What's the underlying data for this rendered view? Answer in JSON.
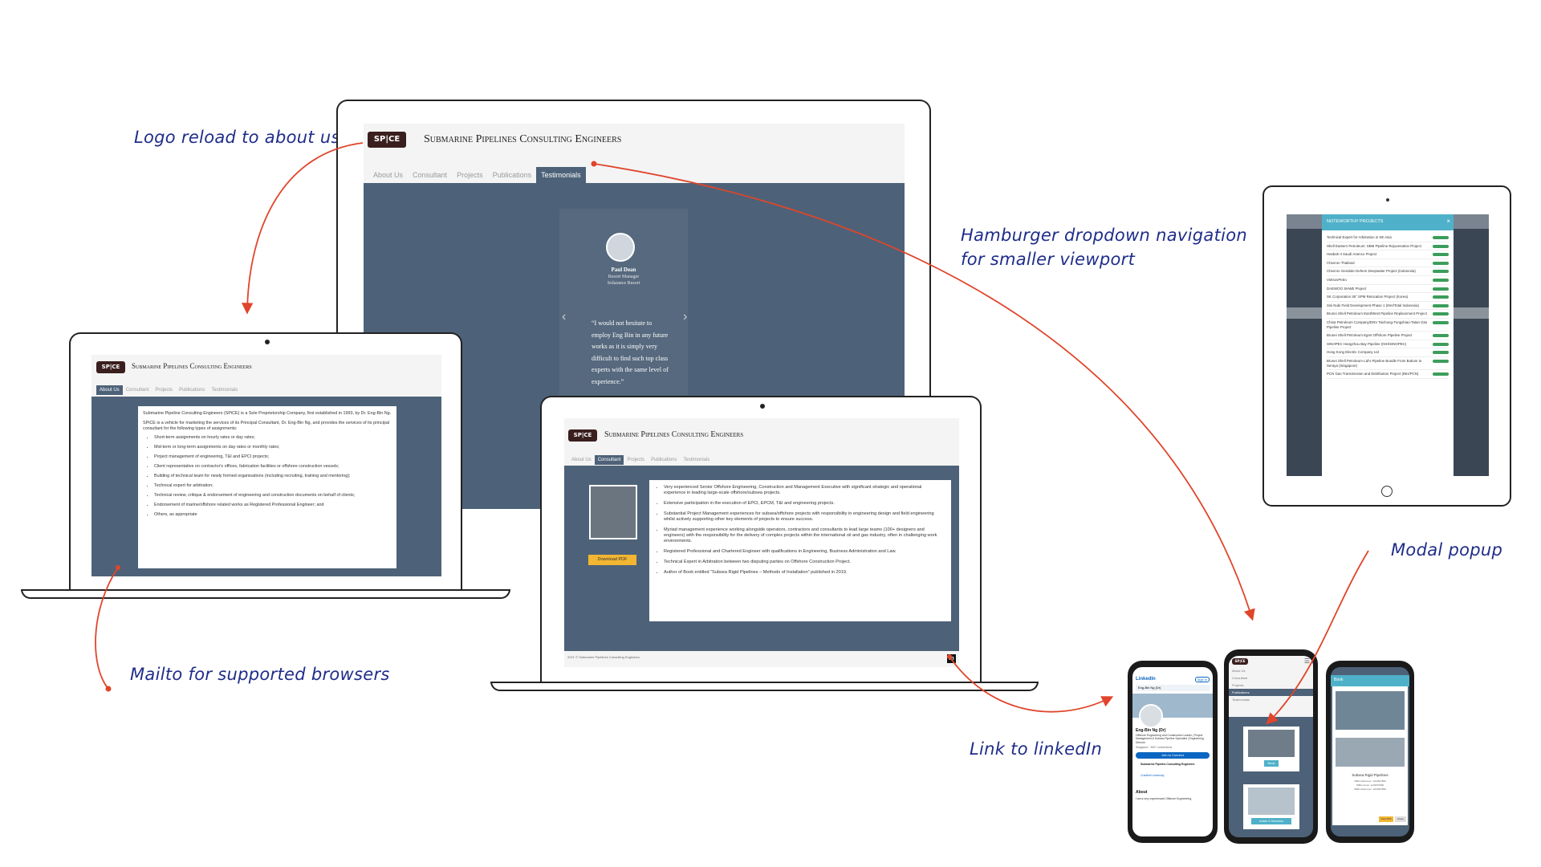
{
  "annotations": {
    "logo_reload": "Logo reload to about us",
    "hamburger": "Hamburger dropdown navigation\nfor smaller viewport",
    "mailto": "Mailto for supported browsers",
    "linkedin": "Link to linkedIn",
    "modal": "Modal popup"
  },
  "site": {
    "logo_text": "SP|CE",
    "title": "Submarine Pipelines Consulting Engineers",
    "tabs": [
      "About Us",
      "Consultant",
      "Projects",
      "Publications",
      "Testimonials"
    ]
  },
  "monitor": {
    "active_tab": "Testimonials",
    "testimonial": {
      "name": "Paul Dean",
      "role": "Resort Manager",
      "company": "Solaiance Resort",
      "quote": "“I would not hesitate to employ Eng Bin in any future works as it is simply very difficult to find such top class experts with the same level of experience.”"
    }
  },
  "laptop_left": {
    "active_tab": "About Us",
    "intro1": "Submarine Pipeline Consulting Engineers (SPiCE) is a Sole Proprietorship Company, first established in 1993, by Dr. Eng-Bin Ng.",
    "intro2": "SPiCE is a vehicle for marketing the services of its Principal Consultant, Dr. Eng-Bin Ng, and provides the services of its principal consultant for the following types of assignments:",
    "items": [
      "Short-term assignments on hourly rates or day rates;",
      "Mid-term or long-term assignments on day rates or monthly rates;",
      "Project management of engineering, T&I and EPCI projects;",
      "Client representative on contractor's offices, fabrication facilities or offshore construction vessels;",
      "Building of technical team for newly formed organisations (including recruiting, training and mentoring);",
      "Technical expert for arbitration;",
      "Technical review, critique & endorsement of engineering and construction documents on behalf of clients;",
      "Endorsement of marine/offshore related works as Registered Professional Engineer; and",
      "Others, as appropriate"
    ]
  },
  "laptop_right": {
    "active_tab": "Consultant",
    "download_label": "Download PDF",
    "items": [
      "Very experienced Senior Offshore Engineering, Construction and Management Executive with significant strategic and operational experience in leading large-scale offshore/subsea projects.",
      "Extensive participation in the execution of EPCI, EPCM, T&I and engineering projects.",
      "Substantial Project Management experiences for subsea/offshore projects with responsibility in engineering design and field engineering whilst actively supporting other key elements of projects to ensure success.",
      "Myriad management experience working alongside operators, contractors and consultants to lead large teams (100+ designers and engineers) with the responsibility for the delivery of complex projects within the international oil and gas industry, often in challenging work environments.",
      "Registered Professional and Chartered Engineer with qualifications in Engineering, Business Administration and Law.",
      "Technical Expert in Arbitration between two disputing parties on Offshore Construction Project.",
      "Author of Book entitled “Subsea Rigid Pipelines – Methods of Installation” published in 2019."
    ],
    "footer": "2021 © Submarine Pipelines Consulting Engineers"
  },
  "tablet": {
    "modal_title": "NOTEWORTHY PROJECTS",
    "projects": [
      "Technical Expert for Arbitration in SE Asia",
      "Shell Eastern Petroleum: SBM Pipeline Rejuvenation Project",
      "Hasbah II Saudi Aramco Project",
      "Chevron Thailand",
      "Chevron Gendalo-Gehem Deepwater Project (Indonesia)",
      "VietsovPetro",
      "DAEWOO SHWE Project",
      "SK Corporation 36\" SPM Relocation Project (Korea)",
      "Sisi Nubi Field Development Phase 1 (INH/Total Indonesia)",
      "Brunei Shell Petroleum East/West Pipeline Replacement Project",
      "China Petroleum Company/DNV Taichung-Tungshiao-Tatan Gas Pipeline Project",
      "Brunei Shell Petroleum Egret Offshore Pipeline Project",
      "SINOPEC Hangzhou Bay Pipeline (INH/SINOPEC)",
      "Hong Kong Electric Company Ltd",
      "Brunei Shell Petroleum Ltd's Pipeline Bundle From Bukom to Seraya (Singapore)",
      "PCN Gas Transmission and Distribution Project (INH/PCN)"
    ]
  },
  "phone_linkedin": {
    "brand": "LinkedIn",
    "search": "Eng-Bin Ng (Dr)",
    "sign_in": "Sign in",
    "name": "Eng-Bin Ng (Dr)",
    "headline": "Offshore Engineering and Construction Leader | Project Management & Subsea Pipeline Specialist | Engineering Director",
    "location": "Singapore · 500+ connections",
    "connect": "Join to Connect",
    "company": "Submarine Pipeline Consulting Engineers",
    "school": "Cranfield University",
    "about_heading": "About",
    "about": "I am a very experienced Offshore Engineering,"
  },
  "phone_nav": {
    "menu": [
      "About Us",
      "Consultant",
      "Projects",
      "Publications",
      "Testimonials"
    ],
    "active": "Publications",
    "btn1": "Book",
    "btn2": "Article & Seminars"
  },
  "phone_book": {
    "header": "Book",
    "title": "Subsea Rigid Pipelines",
    "line1": "ISBN hardcover: 1234567890",
    "line2": "ISBN ebook: 1234567890",
    "line3": "ISBN Hardcover: 1234567890",
    "btn_pdf": "View PDF",
    "btn_close": "Close"
  },
  "colors": {
    "accent_arrow": "#e0452b",
    "annotation_ink": "#1f2d8a",
    "page_slate": "#4d6278",
    "pdf_button": "#f2b633",
    "linkedin_blue": "#0a66c2",
    "modal_teal": "#4fb1c9",
    "badge_green": "#3c9d5a"
  }
}
